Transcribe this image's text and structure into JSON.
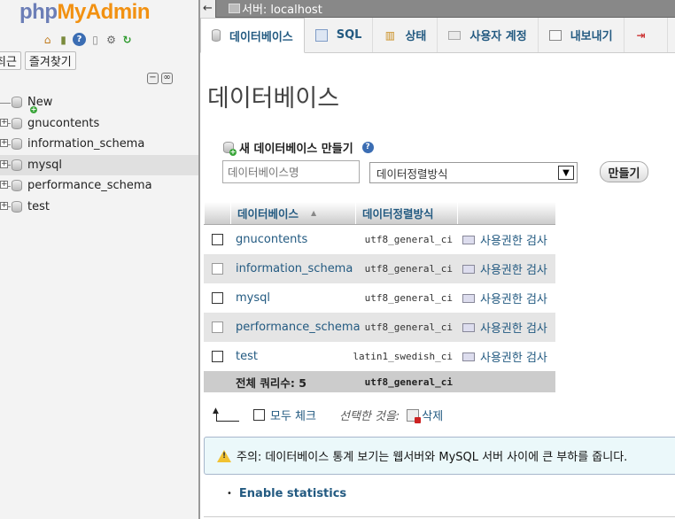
{
  "nav": {
    "logo": {
      "php": "php",
      "myadmin": "MyAdmin"
    },
    "icons": [
      "home-icon",
      "exit-icon",
      "help-icon",
      "docs-icon",
      "settings-icon",
      "reload-icon"
    ],
    "tabs": {
      "recent": "최근",
      "favorites": "즐겨찾기"
    },
    "tree": [
      {
        "label": "New",
        "type": "new"
      },
      {
        "label": "gnucontents",
        "type": "db"
      },
      {
        "label": "information_schema",
        "type": "db"
      },
      {
        "label": "mysql",
        "type": "db",
        "active": true
      },
      {
        "label": "performance_schema",
        "type": "db"
      },
      {
        "label": "test",
        "type": "db"
      }
    ]
  },
  "topbar": {
    "back": "←",
    "server": "서버: localhost"
  },
  "tabs": [
    {
      "label": "데이터베이스",
      "icon": "database-icon",
      "active": true
    },
    {
      "label": "SQL",
      "icon": "sql-icon"
    },
    {
      "label": "상태",
      "icon": "status-icon"
    },
    {
      "label": "사용자 계정",
      "icon": "user-accounts-icon"
    },
    {
      "label": "내보내기",
      "icon": "export-icon"
    },
    {
      "label": "",
      "icon": "import-icon"
    }
  ],
  "page_title": "데이터베이스",
  "create": {
    "label": "새 데이터베이스 만들기",
    "name_placeholder": "데이터베이스명",
    "collation_value": "데이터정렬방식",
    "button": "만들기"
  },
  "table": {
    "headers": {
      "name": "데이터베이스",
      "collation": "데이터정렬방식"
    },
    "rows": [
      {
        "name": "gnucontents",
        "collation": "utf8_general_ci",
        "action": "사용권한 검사"
      },
      {
        "name": "information_schema",
        "collation": "utf8_general_ci",
        "action": "사용권한 검사"
      },
      {
        "name": "mysql",
        "collation": "utf8_general_ci",
        "action": "사용권한 검사"
      },
      {
        "name": "performance_schema",
        "collation": "utf8_general_ci",
        "action": "사용권한 검사"
      },
      {
        "name": "test",
        "collation": "latin1_swedish_ci",
        "action": "사용권한 검사"
      }
    ],
    "footer": {
      "total": "전체 쿼리수: 5",
      "collation": "utf8_general_ci"
    }
  },
  "bulk": {
    "check_all": "모두 체크",
    "with_selected": "선택한 것을:",
    "delete": "삭제"
  },
  "notice": "주의: 데이터베이스 통계 보기는 웹서버와 MySQL 서버 사이에 큰 부하를 줍니다.",
  "enable_stats": "Enable statistics",
  "colors": {
    "link": "#235a81",
    "logo_php": "#6c7eb7",
    "logo_myadmin": "#f29111",
    "notice_bg": "#ebf8fa"
  }
}
